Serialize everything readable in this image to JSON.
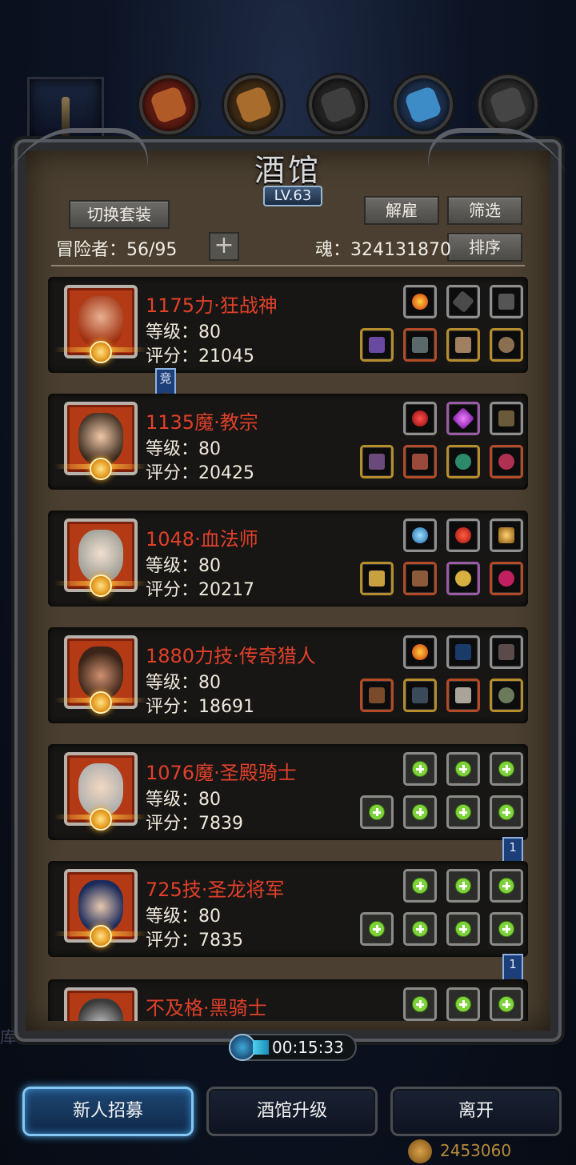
{
  "header": {
    "title": "酒馆",
    "level": "LV.63",
    "tabs": [
      "portrait-tab",
      "leather-tab",
      "wood-tab",
      "iron-tab",
      "crystal-tab",
      "stone-tab"
    ]
  },
  "toolbar": {
    "switch_set_label": "切换套装",
    "dismiss_label": "解雇",
    "filter_label": "筛选",
    "sort_label": "排序",
    "adventurers_text": "冒险者：56/95",
    "add_label": "+",
    "soul_text": "魂：324131870"
  },
  "heroes": [
    {
      "name": "1175力·狂战神",
      "level": "等级：80",
      "score": "评分：21045",
      "badge": "竞",
      "empty_slots": false
    },
    {
      "name": "1135魔·教宗",
      "level": "等级：80",
      "score": "评分：20425",
      "badge": "",
      "empty_slots": false
    },
    {
      "name": "1048·血法师",
      "level": "等级：80",
      "score": "评分：20217",
      "badge": "",
      "empty_slots": false
    },
    {
      "name": "1880力技·传奇猎人",
      "level": "等级：80",
      "score": "评分：18691",
      "badge": "",
      "empty_slots": false
    },
    {
      "name": "1076魔·圣殿骑士",
      "level": "等级：80",
      "score": "评分：7839",
      "badge": "1",
      "empty_slots": true
    },
    {
      "name": "725技·圣龙将军",
      "level": "等级：80",
      "score": "评分：7835",
      "badge": "1",
      "empty_slots": true
    },
    {
      "name": "不及格·黑骑士",
      "level": "",
      "score": "",
      "badge": "",
      "empty_slots": true
    }
  ],
  "footer": {
    "timer": "00:15:33",
    "recruit_label": "新人招募",
    "upgrade_label": "酒馆升级",
    "leave_label": "离开",
    "gold": "2453060",
    "side_text": "库"
  },
  "colors": {
    "hero_name": "#e0402a",
    "panel": "#4a3f30",
    "card": "#171614",
    "primary_button": "#84c6f2",
    "plus": "#7ed23a"
  }
}
